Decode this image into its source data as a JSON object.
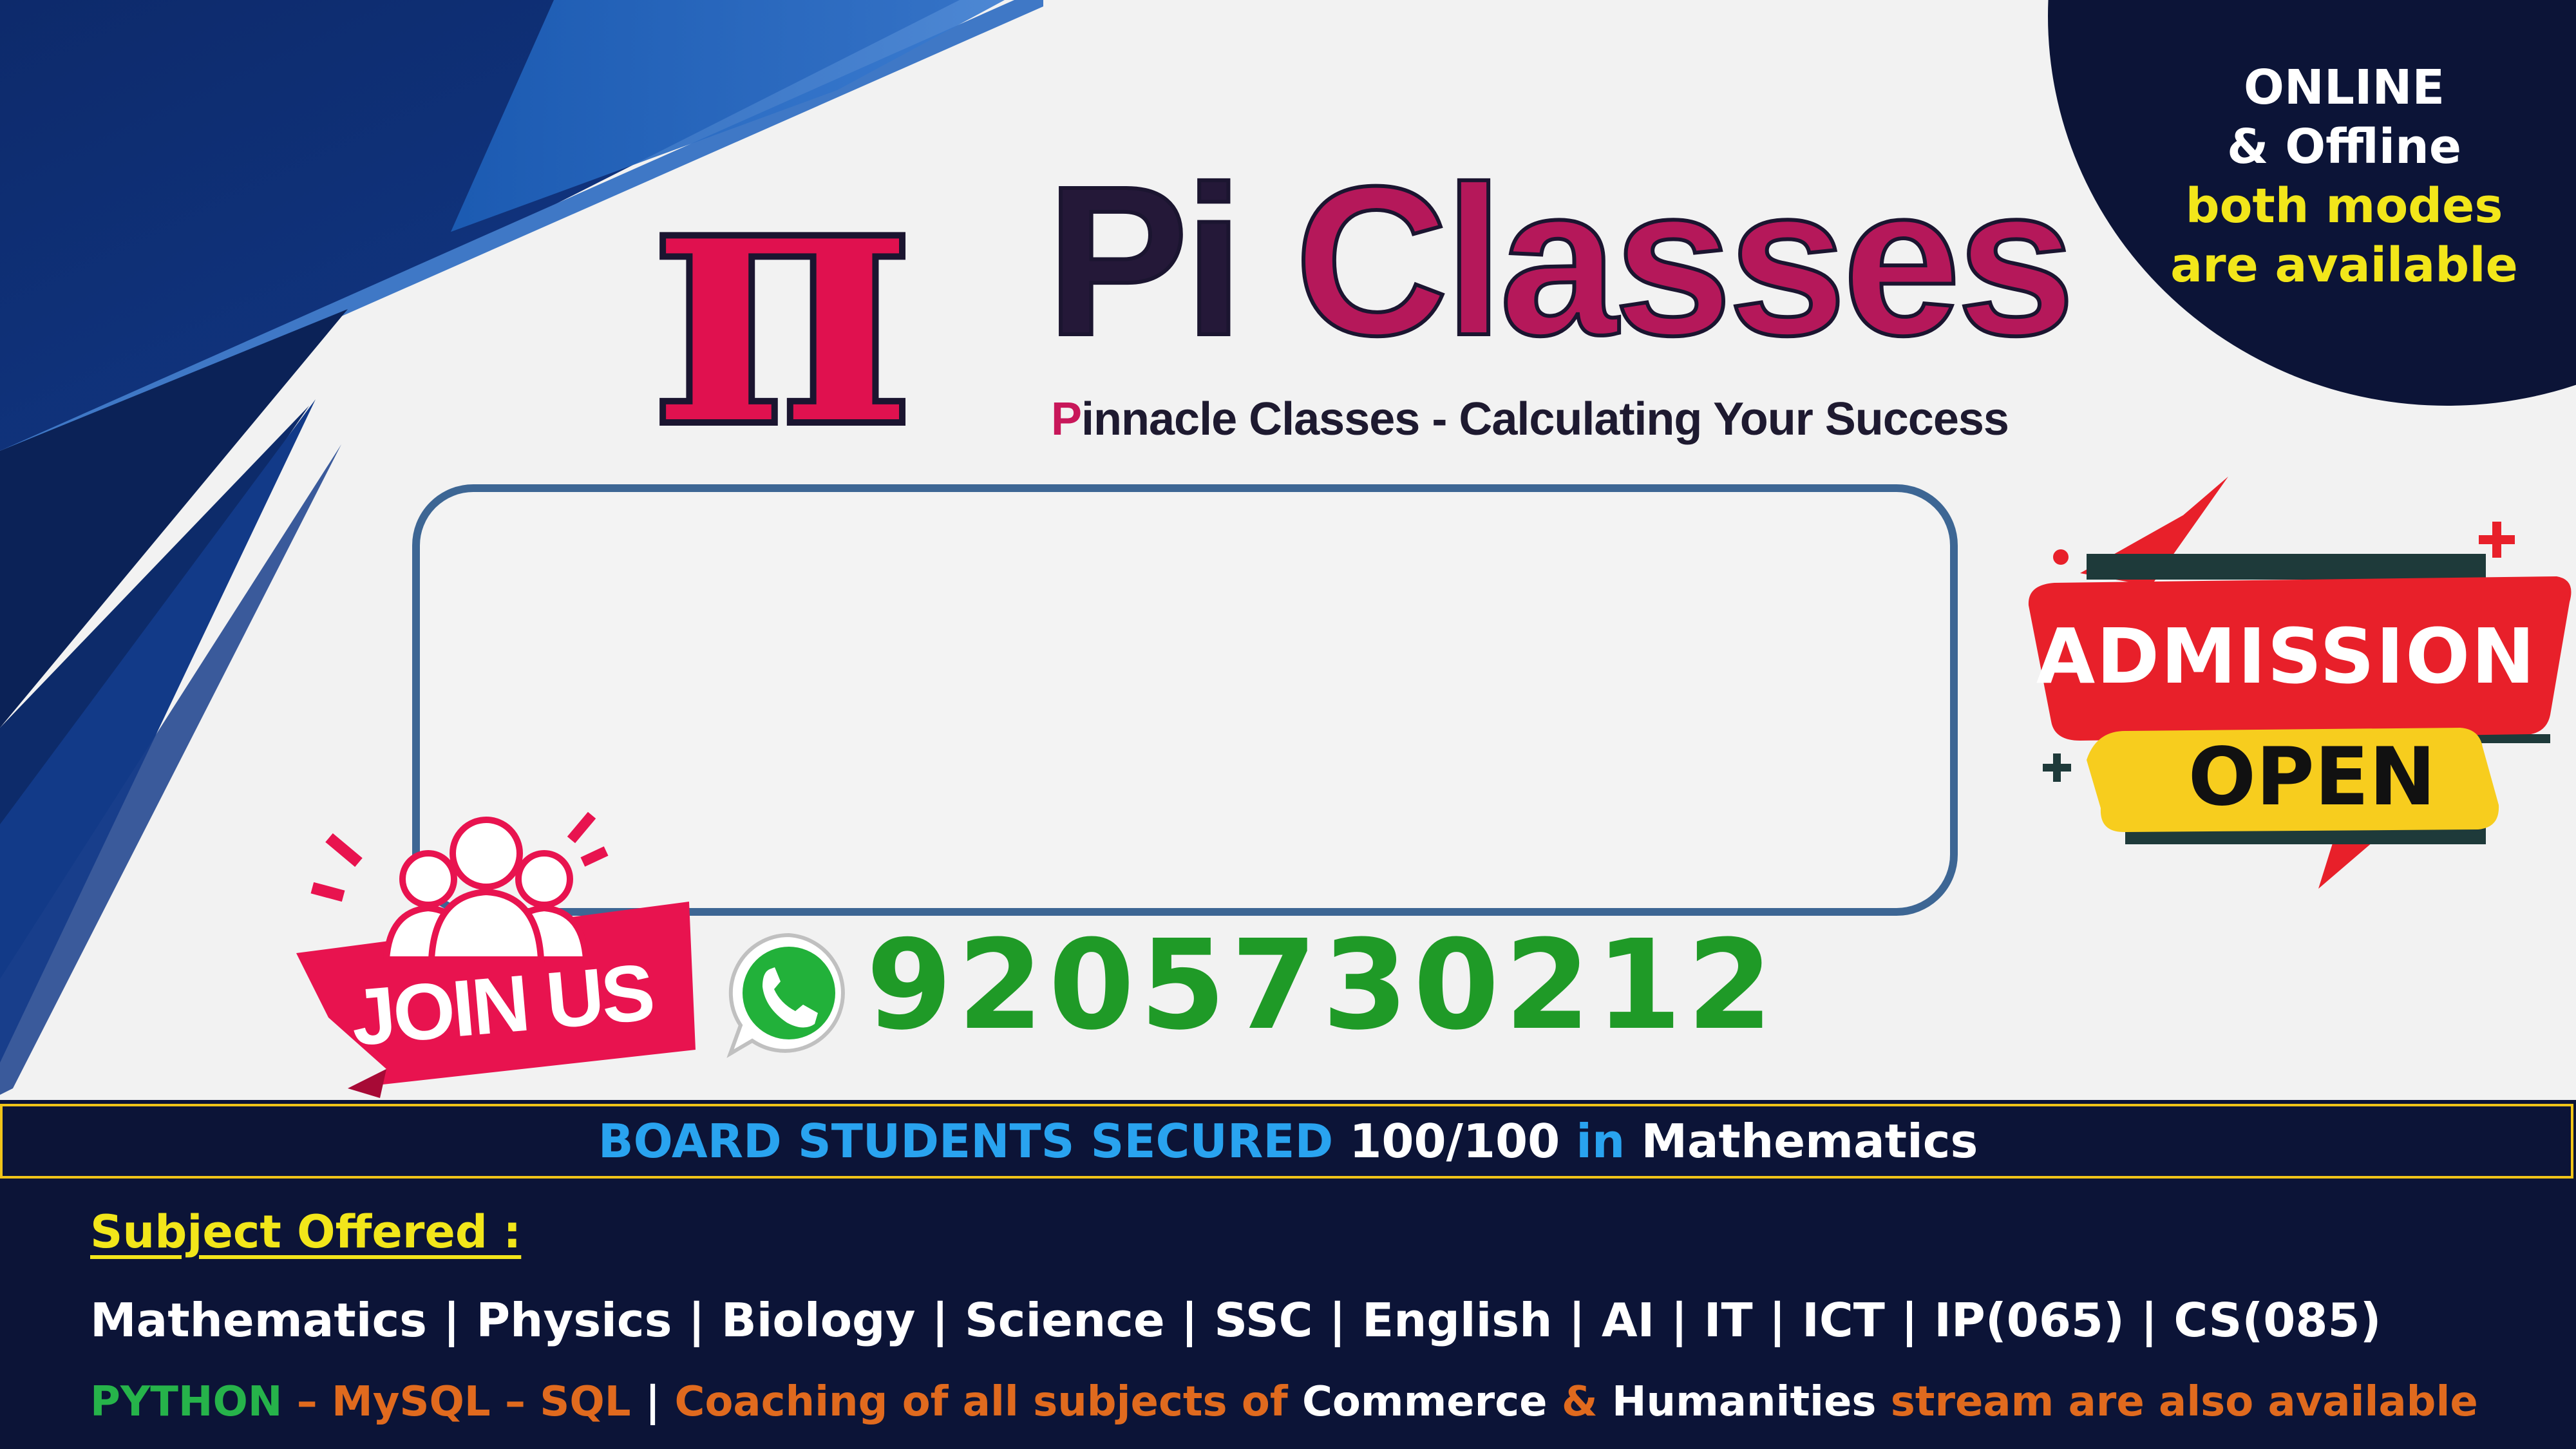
{
  "brand": {
    "symbol": "π",
    "name_first": "Pi",
    "name_rest": " Classes",
    "tagline_initial": "P",
    "tagline_rest": "innacle Classes - Calculating Your Success"
  },
  "modes": {
    "line1": "ONLINE",
    "line2": "& Offline",
    "line3": "both modes",
    "line4": "are available"
  },
  "admission": {
    "label": "ADMISSION",
    "status": "OPEN"
  },
  "join": {
    "label": "JOIN US"
  },
  "contact": {
    "icon": "whatsapp-icon",
    "phone": "9205730212"
  },
  "achievement": {
    "part1": "BOARD STUDENTS SECURED",
    "part2": "100/100",
    "part3": "in",
    "part4": "Mathematics"
  },
  "subjects": {
    "title": "Subject Offered :",
    "list": "Mathematics | Physics | Biology | Science | SSC | English | AI | IT | ICT | IP(065) | CS(085)"
  },
  "extra": {
    "python": "PYTHON",
    "dash1": " – ",
    "mysql": "MySQL",
    "dash2": " – ",
    "sql": "SQL",
    "sep": "  | ",
    "coaching": "Coaching of all subjects of ",
    "commerce": "Commerce",
    "amp": " & ",
    "humanities": "Humanities",
    "stream": " stream are also available"
  },
  "colors": {
    "navy": "#0c1437",
    "pi_red": "#e0114f",
    "brand_magenta": "#b5185a",
    "whatsapp_green": "#1f9a27",
    "highlight_yellow": "#f2e61a",
    "achievement_blue": "#29a3ef",
    "extra_orange": "#e06a1e",
    "python_green": "#26b34a"
  }
}
